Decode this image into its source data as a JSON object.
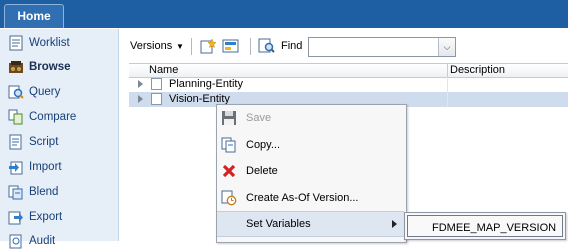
{
  "top_tab": {
    "label": "Home"
  },
  "nav": {
    "items": [
      {
        "label": "Worklist",
        "icon": "worklist-icon"
      },
      {
        "label": "Browse",
        "icon": "browse-icon",
        "active": true
      },
      {
        "label": "Query",
        "icon": "query-icon"
      },
      {
        "label": "Compare",
        "icon": "compare-icon"
      },
      {
        "label": "Script",
        "icon": "script-icon"
      },
      {
        "label": "Import",
        "icon": "import-icon"
      },
      {
        "label": "Blend",
        "icon": "blend-icon"
      },
      {
        "label": "Export",
        "icon": "export-icon"
      },
      {
        "label": "Audit",
        "icon": "audit-icon"
      }
    ]
  },
  "toolbar": {
    "versions_label": "Versions",
    "find_label": "Find",
    "find_value": ""
  },
  "grid": {
    "columns": [
      "Name",
      "Description"
    ],
    "rows": [
      {
        "name": "Planning-Entity",
        "description": "",
        "selected": false
      },
      {
        "name": "Vision-Entity",
        "description": "",
        "selected": true
      }
    ]
  },
  "context_menu": {
    "items": [
      {
        "label": "Save",
        "icon": "save-icon",
        "disabled": true
      },
      {
        "label": "Copy...",
        "icon": "copy-icon"
      },
      {
        "label": "Delete",
        "icon": "delete-icon"
      },
      {
        "label": "Create As-Of Version...",
        "icon": "as-of-version-icon"
      },
      {
        "label": "Set Variables",
        "icon": "",
        "has_submenu": true,
        "highlighted": true
      }
    ]
  },
  "submenu": {
    "items": [
      {
        "label": "FDMEE_MAP_VERSION"
      }
    ]
  },
  "colors": {
    "topbar": "#1e5ea3",
    "nav_bg": "#e6eef7",
    "selected_row": "#cfdcee",
    "nav_text": "#17407a"
  }
}
